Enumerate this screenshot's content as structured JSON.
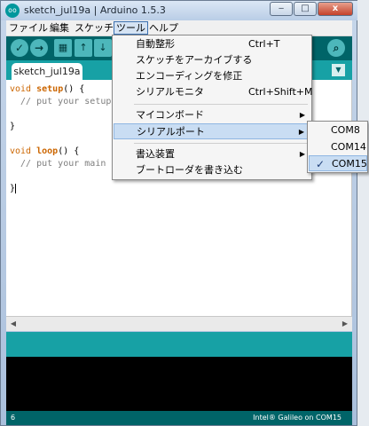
{
  "window": {
    "title": "sketch_jul19a | Arduino 1.5.3",
    "app_icon_text": "oo",
    "minimize": "‒",
    "maximize": "□",
    "close": "x"
  },
  "menubar": {
    "items": [
      "ファイル",
      "編集",
      "スケッチ",
      "ツール",
      "ヘルプ"
    ],
    "active_index": 3
  },
  "toolbar": {
    "verify_icon": "✓",
    "upload_icon": "→",
    "new_icon": "▦",
    "open_icon": "↑",
    "save_icon": "↓",
    "serial_monitor_icon": "⌕"
  },
  "tabs": {
    "items": [
      {
        "label": "sketch_jul19a"
      }
    ],
    "menu_icon": "▼"
  },
  "editor": {
    "lines": [
      {
        "kw": "void ",
        "fn": "setup",
        "rest": "() {"
      },
      {
        "comment": "  // put your setup code"
      },
      {
        "text": ""
      },
      {
        "text": "}"
      },
      {
        "text": ""
      },
      {
        "kw": "void ",
        "fn": "loop",
        "rest": "() {"
      },
      {
        "comment": "  // put your main code"
      },
      {
        "text": ""
      },
      {
        "text": "}"
      }
    ]
  },
  "tools_menu": {
    "items": [
      {
        "label": "自動整形",
        "shortcut": "Ctrl+T"
      },
      {
        "label": "スケッチをアーカイブする",
        "shortcut": ""
      },
      {
        "label": "エンコーディングを修正",
        "shortcut": ""
      },
      {
        "label": "シリアルモニタ",
        "shortcut": "Ctrl+Shift+M"
      },
      {
        "label": "マイコンボード",
        "submenu": true
      },
      {
        "label": "シリアルポート",
        "submenu": true
      },
      {
        "label": "書込装置",
        "submenu": true
      },
      {
        "label": "ブートローダを書き込む",
        "shortcut": ""
      }
    ],
    "highlighted_index": 5
  },
  "serial_port_submenu": {
    "items": [
      {
        "label": "COM8",
        "checked": false
      },
      {
        "label": "COM14",
        "checked": false
      },
      {
        "label": "COM15",
        "checked": true
      }
    ],
    "highlighted_index": 2
  },
  "status": {
    "line_number": "6",
    "board_port": "Intel® Galileo on COM15"
  },
  "colors": {
    "toolbar": "#006468",
    "tabstrip": "#17a1a5",
    "menu_highlight": "#c9ddf3",
    "console": "#000000"
  }
}
